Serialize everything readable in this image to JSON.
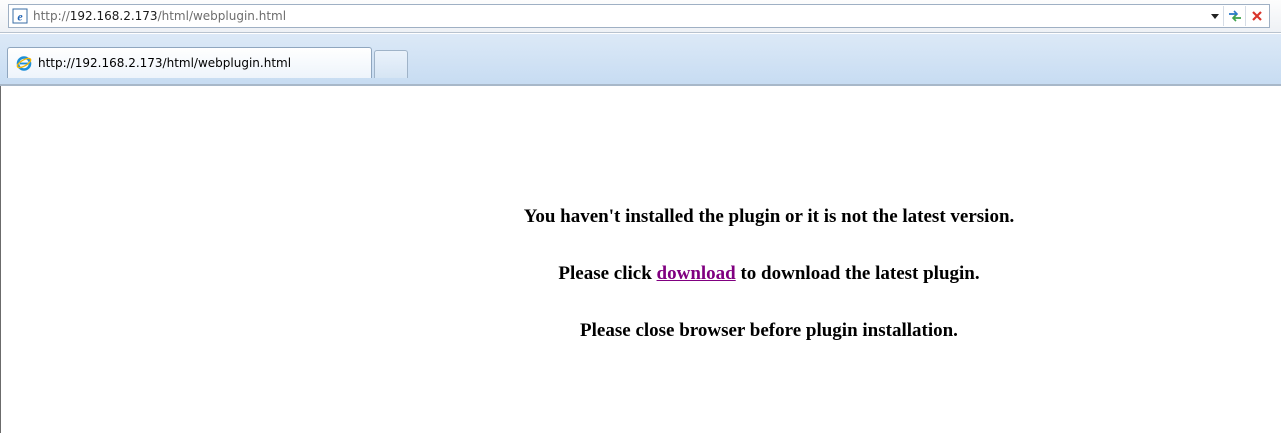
{
  "browser": {
    "address_bar": {
      "url_prefix": "http://",
      "url_host": "192.168.2.173",
      "url_path": "/html/webplugin.html"
    },
    "tabs": [
      {
        "title": "http://192.168.2.173/html/webplugin.html",
        "active": true
      }
    ],
    "icons": {
      "page": "ie-page-icon",
      "tab": "ie-logo-icon",
      "dropdown": "chevron-down-icon",
      "refresh": "refresh-icon",
      "stop": "close-icon"
    },
    "colors": {
      "tabstrip": "#c7dcf2",
      "stop": "#d9342b",
      "refresh": "#2a79c9"
    }
  },
  "page": {
    "line1": "You haven't installed the plugin or it is not the latest version.",
    "line2_before": "Please click ",
    "line2_link": "download",
    "line2_after": " to download the latest plugin.",
    "line3": "Please close browser before plugin installation.",
    "link_color": "#800080"
  }
}
